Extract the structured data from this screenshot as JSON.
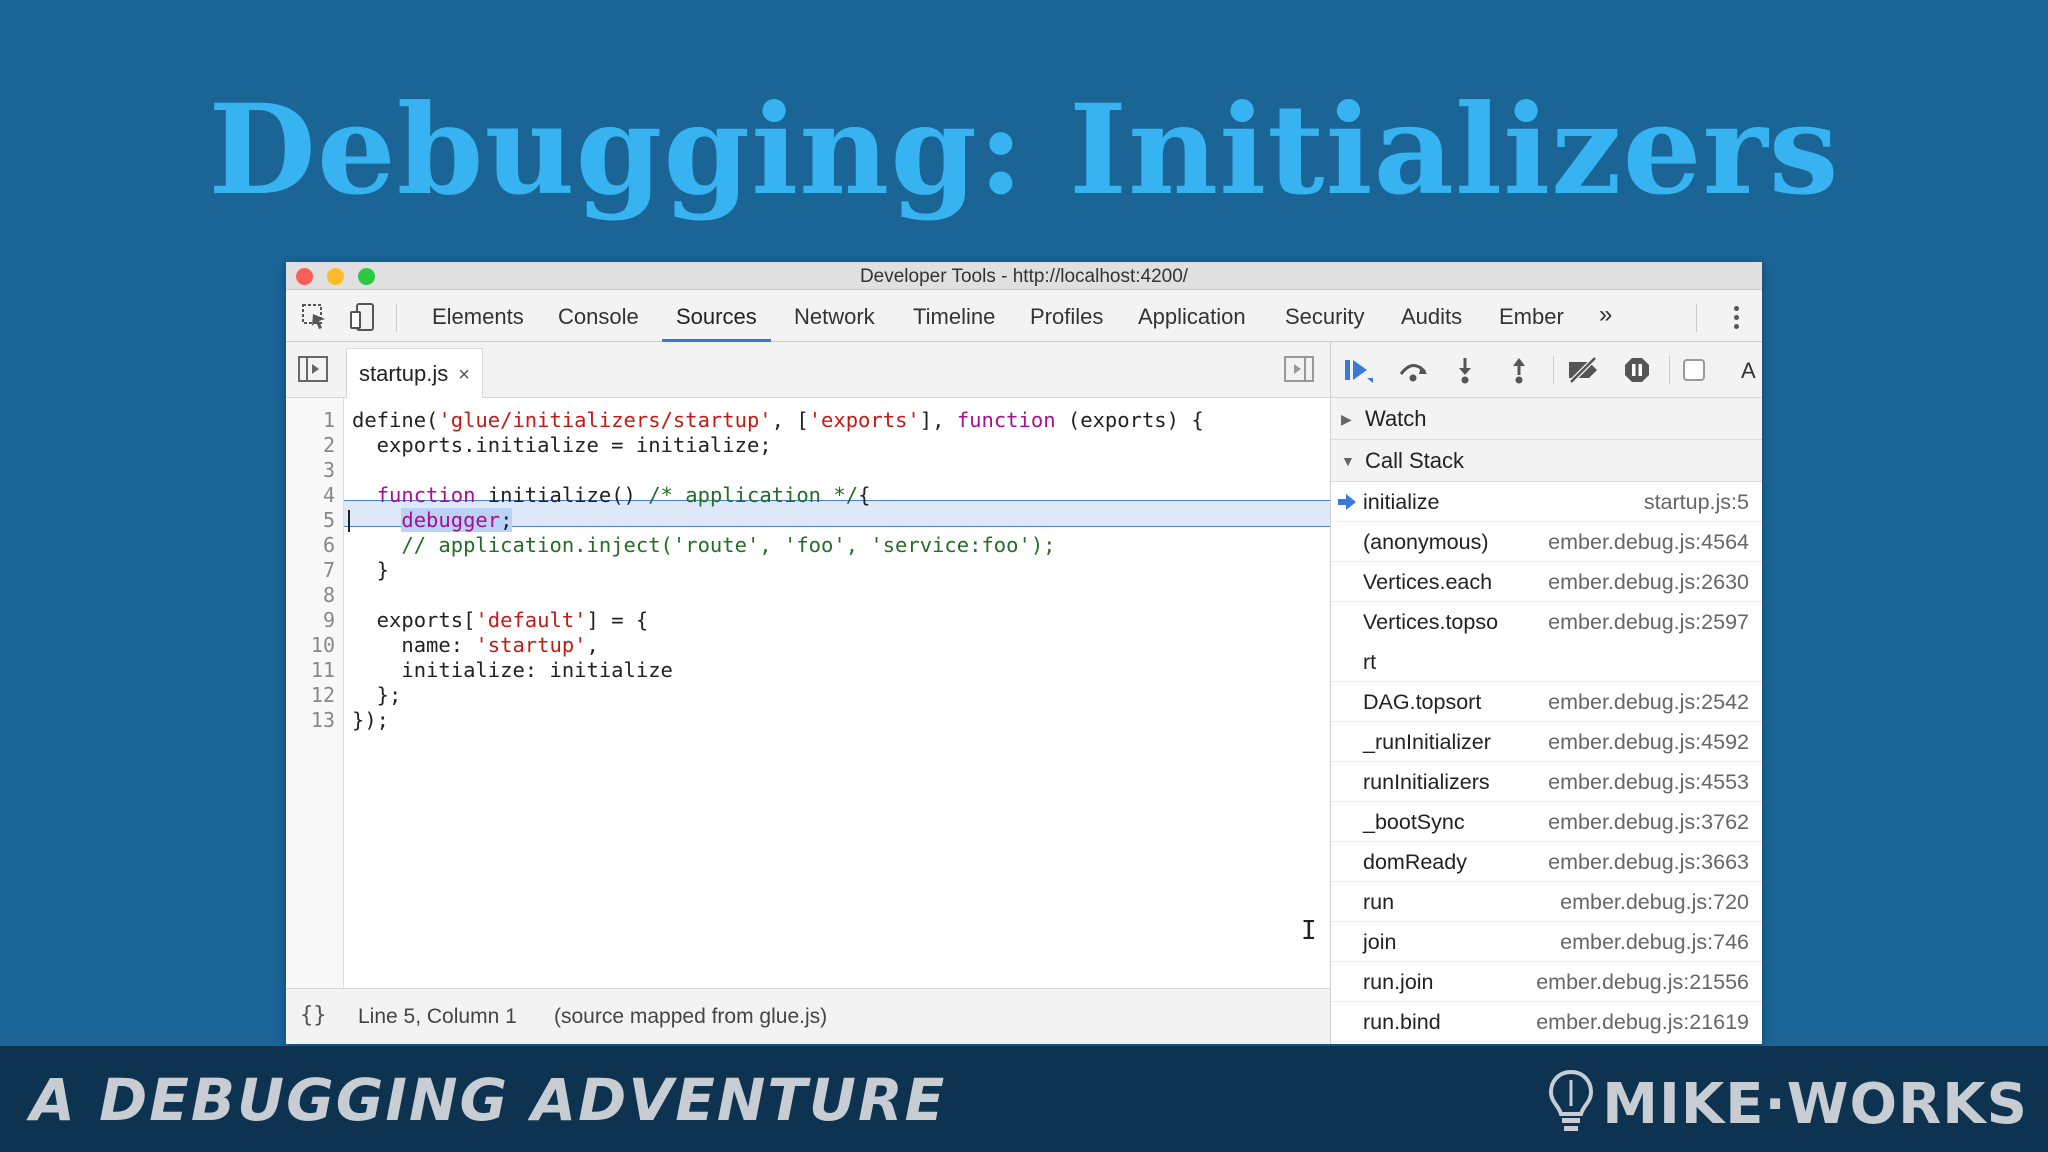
{
  "slide": {
    "title": "Debugging: Initializers",
    "footer_left": "A DEBUGGING ADVENTURE",
    "footer_right": "MIKE·WORKS"
  },
  "window": {
    "title": "Developer Tools - http://localhost:4200/"
  },
  "tabs": [
    {
      "label": "Elements"
    },
    {
      "label": "Console"
    },
    {
      "label": "Sources",
      "active": true
    },
    {
      "label": "Network"
    },
    {
      "label": "Timeline"
    },
    {
      "label": "Profiles"
    },
    {
      "label": "Application"
    },
    {
      "label": "Security"
    },
    {
      "label": "Audits"
    },
    {
      "label": "Ember"
    }
  ],
  "tabs_overflow": "»",
  "file_tab": {
    "name": "startup.js",
    "close": "×"
  },
  "code": {
    "line_numbers": [
      "1",
      "2",
      "3",
      "4",
      "5",
      "6",
      "7",
      "8",
      "9",
      "10",
      "11",
      "12",
      "13"
    ],
    "current_line": 5
  },
  "status": {
    "braces": "{}",
    "position": "Line 5, Column 1",
    "mapped": "(source mapped from glue.js)"
  },
  "debugger": {
    "watch_label": "Watch",
    "call_stack_label": "Call Stack",
    "truncated_label": "A",
    "call_stack": [
      {
        "fn": "initialize",
        "loc": "startup.js:5",
        "current": true
      },
      {
        "fn": "(anonymous)",
        "loc": "ember.debug.js:4564"
      },
      {
        "fn": "Vertices.each",
        "loc": "ember.debug.js:2630"
      },
      {
        "fn": "Vertices.topso",
        "loc": "ember.debug.js:2597"
      },
      {
        "fn": "rt",
        "loc": ""
      },
      {
        "fn": "DAG.topsort",
        "loc": "ember.debug.js:2542"
      },
      {
        "fn": "_runInitializer",
        "loc": "ember.debug.js:4592"
      },
      {
        "fn": "runInitializers",
        "loc": "ember.debug.js:4553"
      },
      {
        "fn": "_bootSync",
        "loc": "ember.debug.js:3762"
      },
      {
        "fn": "domReady",
        "loc": "ember.debug.js:3663"
      },
      {
        "fn": "run",
        "loc": "ember.debug.js:720"
      },
      {
        "fn": "join",
        "loc": "ember.debug.js:746"
      },
      {
        "fn": "run.join",
        "loc": "ember.debug.js:21556"
      },
      {
        "fn": "run.bind",
        "loc": "ember.debug.js:21619"
      }
    ]
  },
  "colors": {
    "slide_bg": "#1a6496",
    "title": "#36b3f0",
    "accent": "#3879d9",
    "keyword": "#aa0d91",
    "string": "#c41a16",
    "comment": "#236e25"
  },
  "code_text": {
    "l1_a": "define(",
    "l1_s1": "'glue/initializers/startup'",
    "l1_b": ", [",
    "l1_s2": "'exports'",
    "l1_c": "], ",
    "l1_kw": "function",
    "l1_d": " (exports) {",
    "l2": "  exports.initialize = initialize;",
    "l4_indent": "  ",
    "l4_kw": "function",
    "l4_a": " initialize() ",
    "l4_cm": "/* application */",
    "l4_b": "{",
    "l5_indent": "    ",
    "l5_kw": "debugger",
    "l5_semi": ";",
    "l6_indent": "    ",
    "l6_cm": "// application.inject('route', 'foo', 'service:foo');",
    "l7": "  }",
    "l9_a": "  exports[",
    "l9_s": "'default'",
    "l9_b": "] = {",
    "l10_a": "    name: ",
    "l10_s": "'startup'",
    "l10_b": ",",
    "l11": "    initialize: initialize",
    "l12": "  };",
    "l13": "});"
  }
}
